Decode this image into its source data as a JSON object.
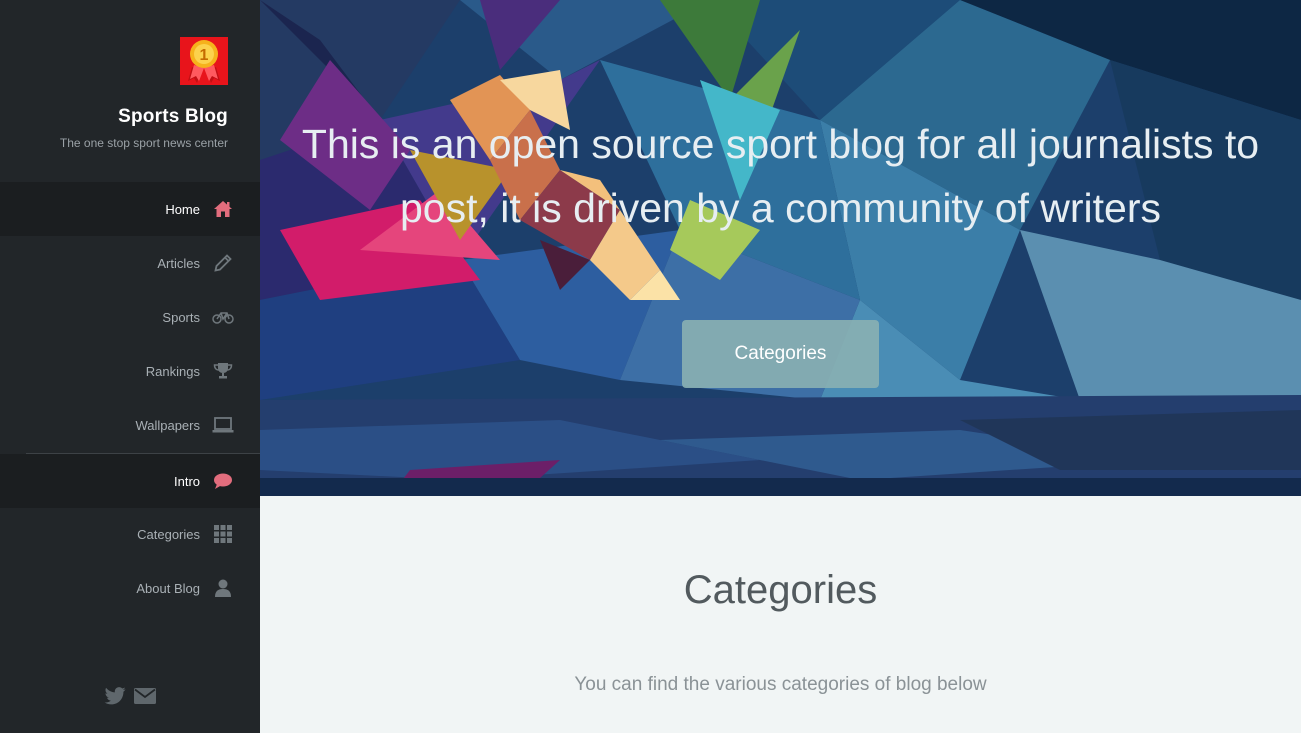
{
  "sidebar": {
    "title": "Sports Blog",
    "tagline": "The one stop sport news center",
    "logo_text": "1",
    "nav": [
      {
        "label": "Home",
        "icon": "home-icon",
        "active": true
      },
      {
        "label": "Articles",
        "icon": "pencil-icon",
        "active": false
      },
      {
        "label": "Sports",
        "icon": "bicycle-icon",
        "active": false
      },
      {
        "label": "Rankings",
        "icon": "trophy-icon",
        "active": false
      },
      {
        "label": "Wallpapers",
        "icon": "laptop-icon",
        "active": false
      },
      {
        "label": "Intro",
        "icon": "chat-bubble-icon",
        "active": true
      },
      {
        "label": "Categories",
        "icon": "grid-icon",
        "active": false
      },
      {
        "label": "About Blog",
        "icon": "user-icon",
        "active": false
      }
    ],
    "social": [
      "twitter-icon",
      "envelope-icon"
    ]
  },
  "hero": {
    "text": "This is an open source sport blog for all journalists to post, it is driven by a community of writers",
    "button_label": "Categories"
  },
  "content": {
    "title": "Categories",
    "description": "You can find the various categories of blog below"
  },
  "colors": {
    "accent": "#e26d7d",
    "sidebar_bg": "#222629",
    "active_bg": "#1b1e20",
    "button_bg": "#8ab0b2"
  }
}
